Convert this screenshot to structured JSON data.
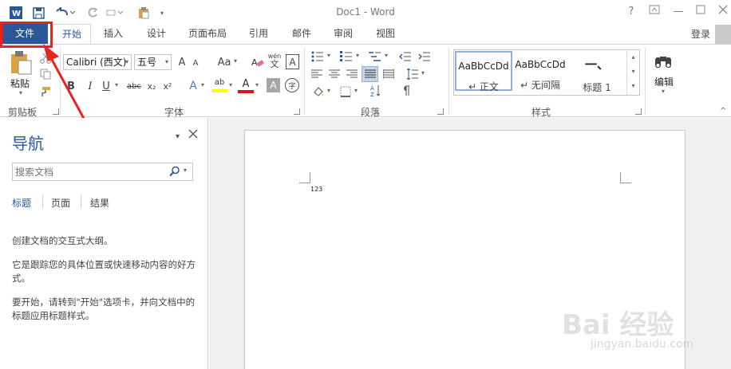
{
  "title_bar": {
    "document_title": "Doc1 - Word",
    "help": "?",
    "min": "—"
  },
  "tabs": [
    {
      "label": "文件"
    },
    {
      "label": "开始"
    },
    {
      "label": "插入"
    },
    {
      "label": "设计"
    },
    {
      "label": "页面布局"
    },
    {
      "label": "引用"
    },
    {
      "label": "邮件"
    },
    {
      "label": "审阅"
    },
    {
      "label": "视图"
    }
  ],
  "login": "登录",
  "ribbon": {
    "clipboard": {
      "paste_label": "粘贴",
      "group_label": "剪贴板"
    },
    "font": {
      "font_name": "Calibri (西文)",
      "font_size": "五号",
      "bold": "B",
      "italic": "I",
      "underline": "U",
      "strike": "abc",
      "subscript": "x₂",
      "superscript": "x²",
      "grow": "A",
      "shrink": "A",
      "case": "Aa",
      "text_effect": "A",
      "highlight": "ab",
      "font_color": "A",
      "char_shade": "A",
      "enclose": "字",
      "phonetic_top": "wén",
      "phonetic_bottom": "文",
      "char_border": "A",
      "group_label": "字体"
    },
    "paragraph": {
      "group_label": "段落"
    },
    "styles": {
      "items": [
        {
          "sample": "AaBbCcDd",
          "name": "↵ 正文"
        },
        {
          "sample": "AaBbCcDd",
          "name": "↵ 无间隔"
        },
        {
          "sample": "一、",
          "name": "标题 1"
        }
      ],
      "group_label": "样式"
    },
    "editing": {
      "label": "编辑"
    }
  },
  "nav_pane": {
    "title": "导航",
    "search_placeholder": "搜索文档",
    "tabs": [
      "标题",
      "页面",
      "结果"
    ],
    "paragraphs": [
      "创建文档的交互式大纲。",
      "它是跟踪您的具体位置或快速移动内容的好方式。",
      "要开始，请转到\"开始\"选项卡，并向文档中的标题应用标题样式。"
    ]
  },
  "document": {
    "text": "123"
  },
  "watermark": {
    "logo": "Bai 经验",
    "url": "jingyan.baidu.com"
  },
  "colors": {
    "accent": "#2b579a",
    "highlight_box": "#e8241f",
    "arrow": "#e8241f"
  }
}
